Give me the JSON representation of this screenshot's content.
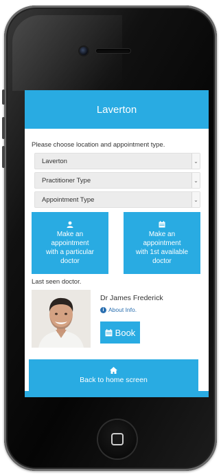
{
  "header": {
    "title": "Laverton"
  },
  "prompt": "Please choose location and appointment type.",
  "selects": [
    {
      "value": "Laverton"
    },
    {
      "value": "Practitioner Type"
    },
    {
      "value": "Appointment Type"
    }
  ],
  "actions": {
    "particular": {
      "line1": "Make an",
      "line2": "appointment",
      "line3": "with a particular",
      "line4": "doctor",
      "icon": "user-icon"
    },
    "first_available": {
      "line1": "Make an",
      "line2": "appointment",
      "line3": "with 1st available",
      "line4": "doctor",
      "icon": "calendar-icon"
    }
  },
  "last_seen": {
    "label": "Last seen doctor.",
    "doctor_name": "Dr James Frederick",
    "about_label": "About Info.",
    "book_label": "Book"
  },
  "footer": {
    "home_label": "Back to home screen",
    "icon": "home-icon"
  },
  "colors": {
    "accent": "#29abe2",
    "link": "#2a6fb0"
  }
}
